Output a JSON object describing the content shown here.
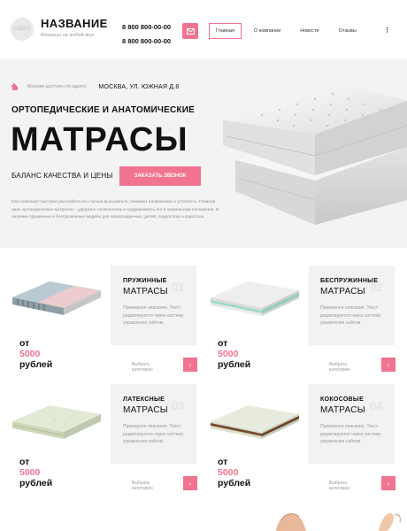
{
  "header": {
    "logo_text": "LOGO",
    "brand_name": "НАЗВАНИЕ",
    "brand_tagline": "Матрасы на любой вкус",
    "phone_1": "8 800 800-00-00",
    "phone_2": "8 800 800-00-00",
    "mail_icon": "envelope-icon",
    "nav": [
      "Главная",
      "О компании",
      "Новости",
      "Отзывы"
    ],
    "nav_active": "Главная",
    "nav_more": "⋮"
  },
  "hero": {
    "address_label": "Магазин доступен по адресу",
    "address_value": "МОСКВА, УЛ. ЮЖНАЯ Д.8",
    "subtitle": "ОРТОПЕДИЧЕСКИЕ И АНАТОМИЧЕСКИЕ",
    "title": "МАТРАСЫ",
    "balance": "БАЛАНС КАЧЕСТВА И ЦЕНЫ",
    "cta_label": "ЗАКАЗАТЬ ЗВОНОК",
    "description": "Они помогают быстрее расслабиться и лучше высыпаться, снимают напряжение и усталость. Главная цель ортопедических матрасов – удержать позвоночник и поддерживать его в правильном положении. В наличии пружинные и беспружинные модели для новорожденных, детей, подростков и взрослых."
  },
  "products": [
    {
      "title_1": "ПРУЖИННЫЕ",
      "title_2": "МАТРАСЫ",
      "num": "01",
      "desc": "Примерное описание. Текст редактируется через систему управления сайтом.",
      "price_prefix": "от",
      "price": "5000",
      "price_suffix": "рублей",
      "link": "Выбрать категорию"
    },
    {
      "title_1": "БЕСПРУЖИННЫЕ",
      "title_2": "МАТРАСЫ",
      "num": "02",
      "desc": "Примерное описание. Текст редактируется через систему управления сайтом.",
      "price_prefix": "от",
      "price": "5000",
      "price_suffix": "рублей",
      "link": "Выбрать категорию"
    },
    {
      "title_1": "ЛАТЕКСНЫЕ",
      "title_2": "МАТРАСЫ",
      "num": "03",
      "desc": "Примерное описание. Текст редактируется через систему управления сайтом.",
      "price_prefix": "от",
      "price": "5000",
      "price_suffix": "рублей",
      "link": "Выбрать категорию"
    },
    {
      "title_1": "КОКОСОВЫЕ",
      "title_2": "МАТРАСЫ",
      "num": "04",
      "desc": "Примерное описание. Текст редактируется через систему управления сайтом.",
      "price_prefix": "от",
      "price": "5000",
      "price_suffix": "рублей",
      "link": "Выбрать категорию"
    }
  ],
  "colors": {
    "accent": "#f0738f",
    "panel": "#f2f2f2",
    "hero_bg": "#f3f3f3"
  }
}
